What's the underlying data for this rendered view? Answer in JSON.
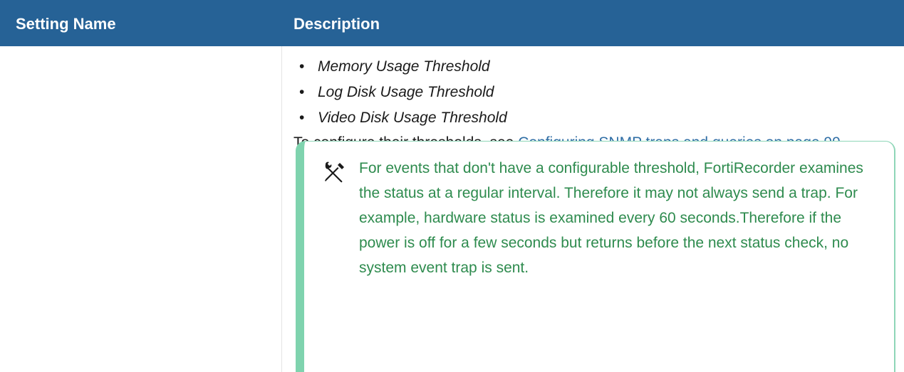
{
  "table": {
    "headers": {
      "setting_name": "Setting Name",
      "description": "Description"
    },
    "description": {
      "bullets": [
        "Memory Usage Threshold",
        "Log Disk Usage Threshold",
        "Video Disk Usage Threshold"
      ],
      "bullet_symbol": "•",
      "paragraph": {
        "text_before": "To configure their thresholds, see ",
        "link_text": "Configuring SNMP traps and queries on page 99",
        "text_after": "."
      },
      "note": {
        "icon": "tools-icon",
        "text": "For events that don't have a configurable threshold, FortiRecorder examines the status at a regular interval. Therefore it may not always send a trap. For example, hardware status is examined every 60 seconds.Therefore if the power is off for a few seconds but returns before the next status check, no system event trap is sent."
      }
    }
  },
  "colors": {
    "header_bg": "#266296",
    "link": "#2f6ea5",
    "note_text": "#2e8b4e",
    "note_border": "#7fd3ae"
  }
}
